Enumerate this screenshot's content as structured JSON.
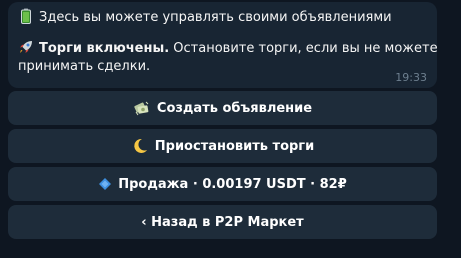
{
  "message": {
    "line1_icon": "battery-icon",
    "line1_text": "Здесь вы можете управлять своими объявлениями",
    "line2_icon": "rocket-icon",
    "line2_bold": "Торги включены.",
    "line2_text": " Остановите торги, если вы не можете",
    "line3_text": "принимать сделки.",
    "time": "19:33"
  },
  "keyboard": {
    "buttons": [
      {
        "icon": "money-icon",
        "label": "Создать объявление"
      },
      {
        "icon": "crescent-moon-icon",
        "label": "Приостановить торги"
      },
      {
        "icon": "blue-diamond-icon",
        "label": "Продажа · 0.00197 USDT · 82₽"
      },
      {
        "icon": "",
        "label": "‹ Назад в P2P Маркет"
      }
    ]
  },
  "colors": {
    "background": "#0e1621",
    "bubble": "#182533",
    "button": "#1e2c3a",
    "time": "#6d7f8f"
  }
}
